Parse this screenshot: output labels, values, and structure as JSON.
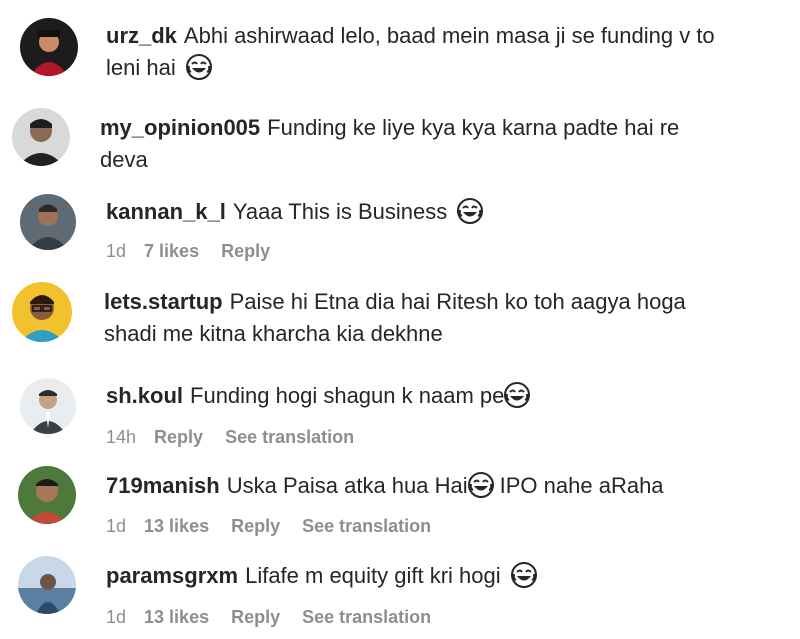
{
  "comments": [
    {
      "username": "urz_dk",
      "text": "Abhi ashirwaad lelo, baad mein masa ji se funding v to",
      "text2": "leni hai",
      "emoji": "joy-emoji"
    },
    {
      "username": "my_opinion005",
      "text": "Funding ke liye kya kya karna padte hai re",
      "text2": "deva"
    },
    {
      "username": "kannan_k_l",
      "text": "Yaaa This is Business",
      "emoji": "joy-emoji",
      "time": "1d",
      "likes": "7 likes",
      "reply": "Reply"
    },
    {
      "username": "lets.startup",
      "text": "Paise hi Etna dia hai Ritesh ko toh aagya hoga",
      "text2": "shadi me kitna kharcha kia dekhne"
    },
    {
      "username": "sh.koul",
      "text": "Funding hogi shagun k naam pe",
      "emoji": "joy-emoji",
      "time": "14h",
      "reply": "Reply",
      "translate": "See translation"
    },
    {
      "username": "719manish",
      "text": "Uska Paisa atka hua Hai",
      "text_after": "IPO nahe aRaha",
      "emoji": "joy-emoji",
      "time": "1d",
      "likes": "13 likes",
      "reply": "Reply",
      "translate": "See translation"
    },
    {
      "username": "paramsgrxm",
      "text": "Lifafe m equity gift kri hogi",
      "emoji": "joy-emoji",
      "time": "1d",
      "likes": "13 likes",
      "reply": "Reply",
      "translate": "See translation"
    }
  ]
}
